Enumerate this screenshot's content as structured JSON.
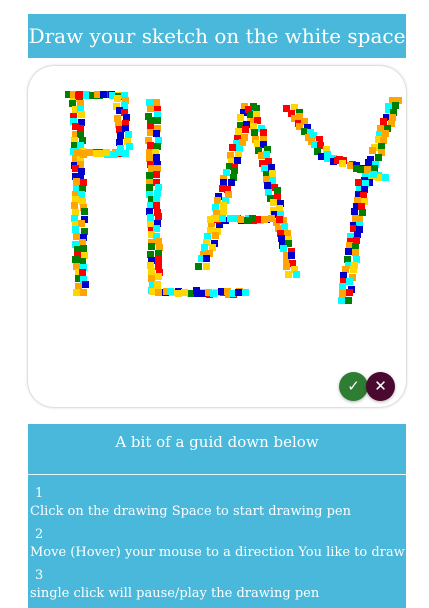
{
  "header": {
    "title": "Draw your sketch on the white space"
  },
  "canvas": {
    "sketch_word": "PLAY",
    "palette": [
      "#ff0000",
      "#ffd700",
      "#0000cc",
      "#00ffff",
      "#008000",
      "#ffa500"
    ]
  },
  "actions": {
    "confirm_icon": "✓",
    "close_icon": "✕"
  },
  "guide": {
    "title": "A bit of a guid down below",
    "steps": [
      {
        "number": "1",
        "text": "Click on the drawing Space to start drawing pen"
      },
      {
        "number": "2",
        "text": "Move (Hover) your mouse to a direction You like to draw"
      },
      {
        "number": "3",
        "text": "single click will pause/play the drawing pen"
      }
    ]
  },
  "colors": {
    "header_bg": "#49b8da",
    "confirm_bg": "#2e7d32",
    "close_bg": "#4a0a30"
  }
}
